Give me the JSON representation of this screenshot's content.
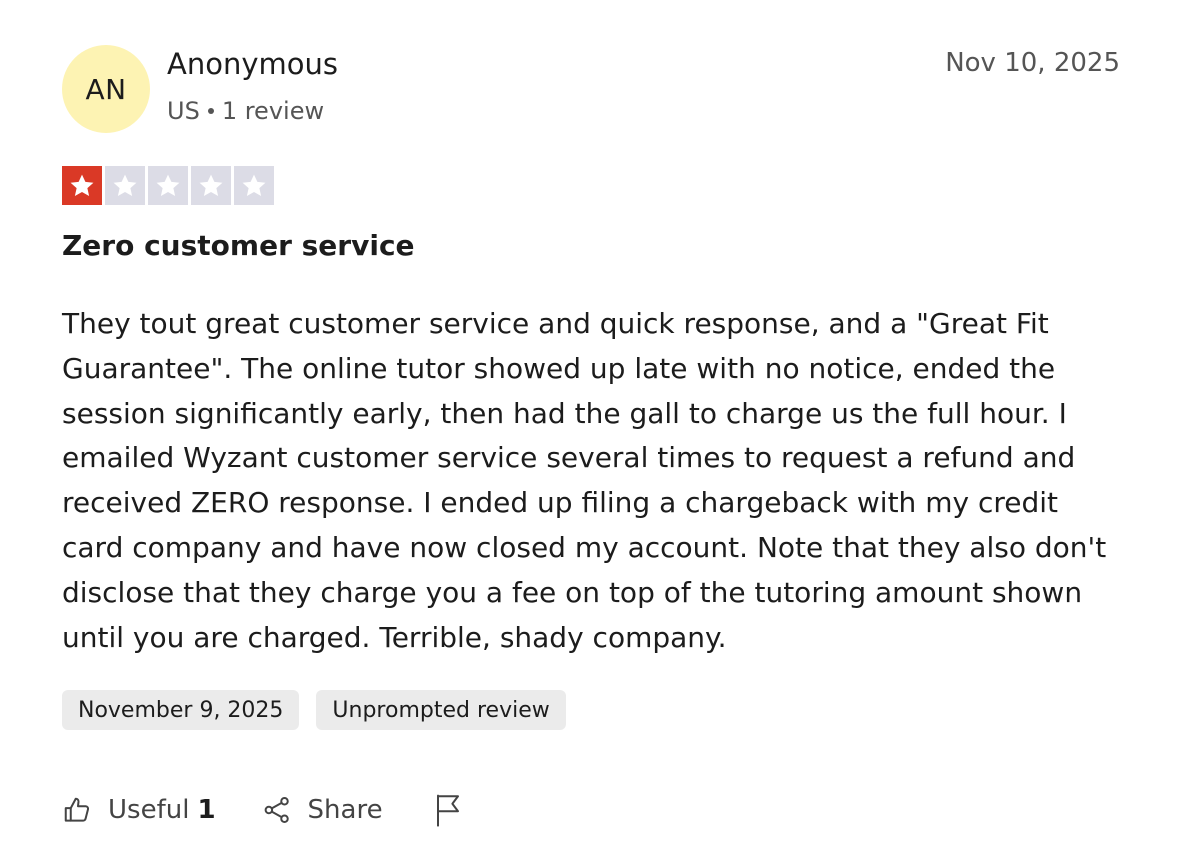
{
  "reviewer": {
    "initials": "AN",
    "name": "Anonymous",
    "country": "US",
    "review_count": "1 review",
    "avatar_color": "#fdf3b3"
  },
  "review": {
    "date": "Nov 10, 2025",
    "rating": 1,
    "max_rating": 5,
    "rating_color": "#da3926",
    "empty_star_color": "#dcdce6",
    "title": "Zero customer service",
    "body": "They tout great customer service and quick response, and a \"Great Fit Guarantee\". The online tutor showed up late with no notice, ended the session significantly early, then had the gall to charge us the full hour. I emailed Wyzant customer service several times to request a refund and received ZERO response. I ended up filing a chargeback with my credit card company and have now closed my account. Note that they also don't disclose that they charge you a fee on top of the tutoring amount shown until you are charged. Terrible, shady company."
  },
  "tags": {
    "experience_date": "November 9, 2025",
    "review_type": "Unprompted review"
  },
  "actions": {
    "useful_label": "Useful",
    "useful_count": "1",
    "share_label": "Share",
    "useful_icon": "thumbs-up-icon",
    "share_icon": "share-icon",
    "report_icon": "flag-icon"
  }
}
